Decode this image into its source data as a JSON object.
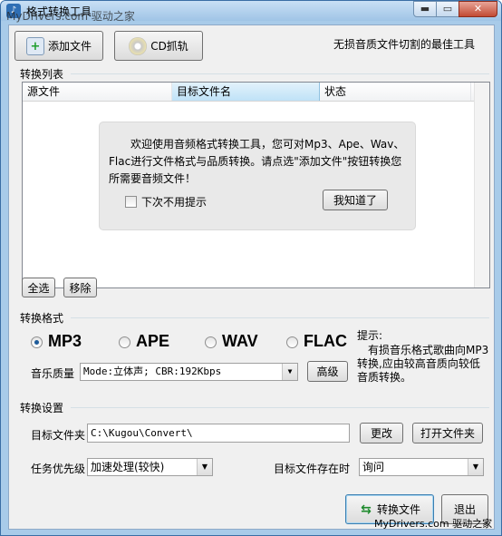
{
  "window": {
    "title": "格式转换工具",
    "watermark": "MyDrivers.com 驱动之家",
    "min_glyph": "▬",
    "max_glyph": "▭",
    "close_glyph": "✕"
  },
  "toolbar": {
    "add_file_label": "添加文件",
    "cd_rip_label": "CD抓轨",
    "slogan": "无损音质文件切割的最佳工具"
  },
  "conversion_list": {
    "group_label": "转换列表",
    "columns": [
      "源文件",
      "目标文件名",
      "状态"
    ],
    "welcome_text": "欢迎使用音频格式转换工具，您可对Mp3、Ape、Wav、Flac进行文件格式与品质转换。请点选\"添加文件\"按钮转换您所需要音频文件！",
    "dont_show_label": "下次不用提示",
    "dont_show_checked": false,
    "got_it_label": "我知道了",
    "select_all_label": "全选",
    "remove_label": "移除"
  },
  "format": {
    "group_label": "转换格式",
    "options": [
      {
        "label": "MP3",
        "selected": true
      },
      {
        "label": "APE",
        "selected": false
      },
      {
        "label": "WAV",
        "selected": false
      },
      {
        "label": "FLAC",
        "selected": false
      }
    ],
    "quality_label": "音乐质量",
    "quality_value": "Mode:立体声; CBR:192Kbps",
    "advanced_label": "高级",
    "hint_title": "提示:",
    "hint_text": "有损音乐格式歌曲向MP3转换,应由较高音质向较低音质转换。"
  },
  "settings": {
    "group_label": "转换设置",
    "target_folder_label": "目标文件夹",
    "target_folder_value": "C:\\Kugou\\Convert\\",
    "change_label": "更改",
    "open_folder_label": "打开文件夹",
    "priority_label": "任务优先级",
    "priority_value": "加速处理(较快)",
    "exists_label": "目标文件存在时",
    "exists_value": "询问"
  },
  "actions": {
    "convert_label": "转换文件",
    "exit_label": "退出"
  },
  "footer": {
    "watermark": "MyDrivers.com 驱动之家"
  },
  "colors": {
    "titlebar": "#a8cbe9",
    "panel": "#f0f0f0",
    "radio_dot": "#1d5b9a"
  }
}
